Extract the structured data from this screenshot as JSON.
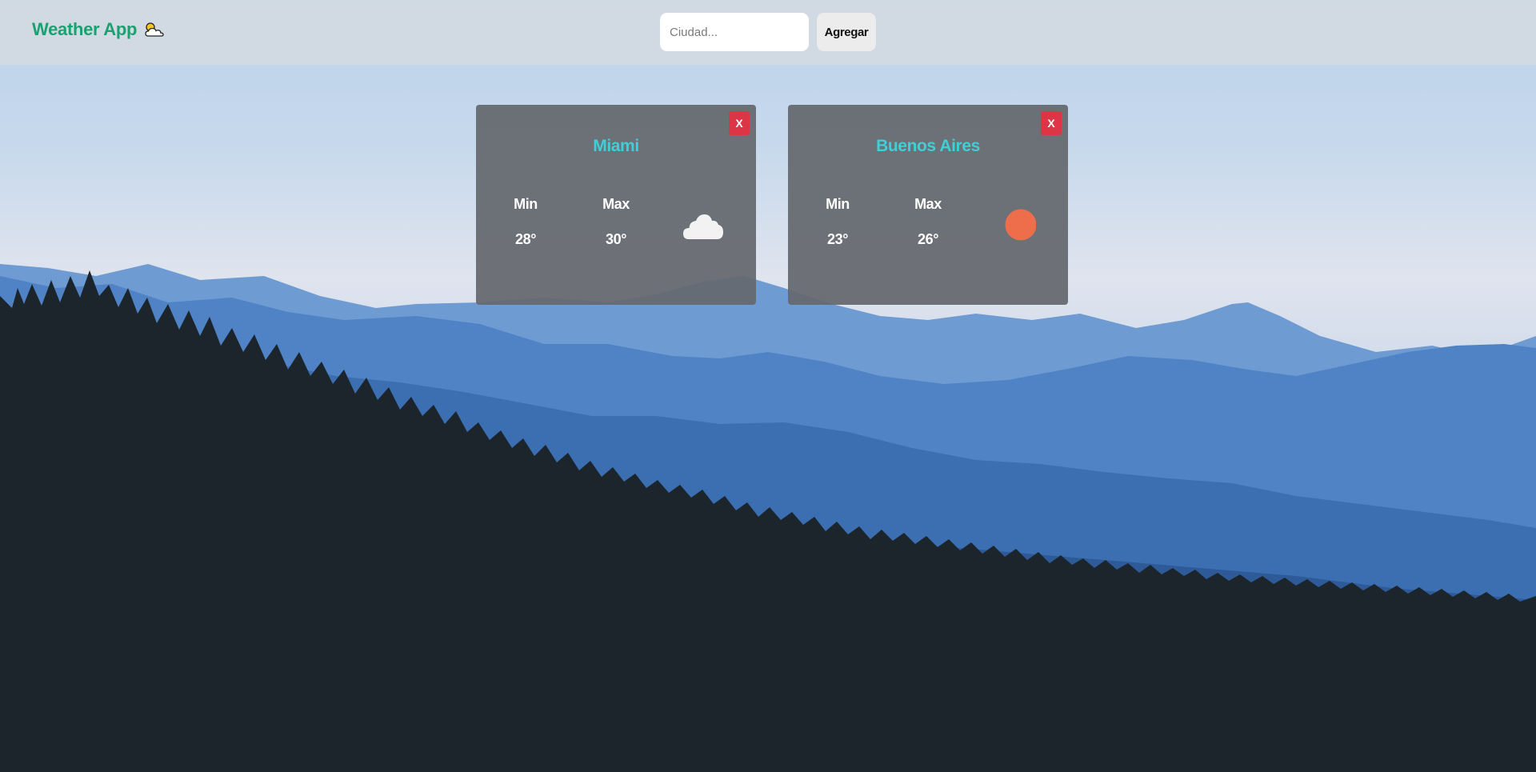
{
  "navbar": {
    "brand_title": "Weather App",
    "brand_icon": "sun-behind-cloud-icon",
    "search_placeholder": "Ciudad...",
    "search_value": "",
    "add_label": "Agregar"
  },
  "cards": [
    {
      "city": "Miami",
      "min_label": "Min",
      "max_label": "Max",
      "min": "28°",
      "max": "30°",
      "icon": "cloud-icon",
      "close_label": "X"
    },
    {
      "city": "Buenos Aires",
      "min_label": "Min",
      "max_label": "Max",
      "min": "23°",
      "max": "26°",
      "icon": "sun-icon",
      "close_label": "X"
    }
  ],
  "colors": {
    "brand": "#1aa172",
    "city_name": "#3fcfd6",
    "close_button": "#dc3545",
    "sun": "#ee6e4c",
    "card_bg": "#64686e"
  }
}
